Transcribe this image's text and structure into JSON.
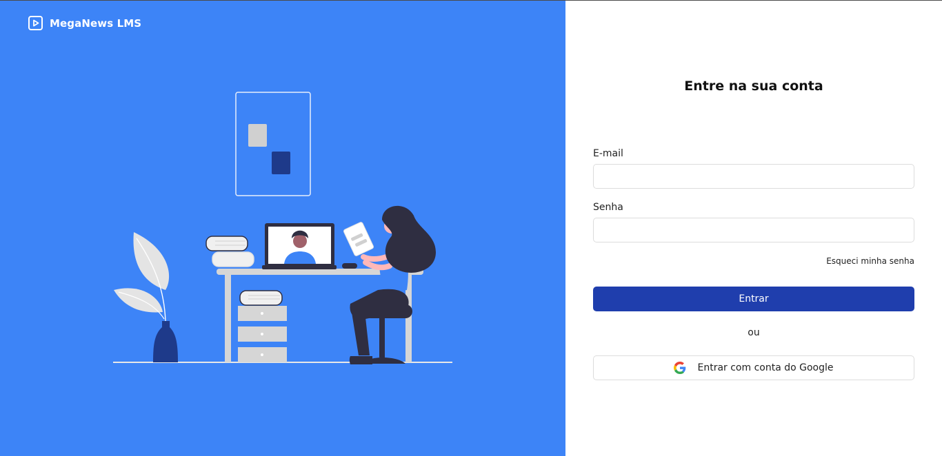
{
  "brand": {
    "name": "MegaNews LMS",
    "icon": "play-square-icon"
  },
  "login": {
    "title": "Entre na sua conta",
    "email_label": "E-mail",
    "email_value": "",
    "password_label": "Senha",
    "password_value": "",
    "forgot_link": "Esqueci minha senha",
    "submit_label": "Entrar",
    "divider_text": "ou",
    "google_label": "Entrar com conta do Google",
    "google_icon": "google-g-icon"
  },
  "colors": {
    "panel_blue": "#3d84f7",
    "primary_button": "#1f3ead",
    "dark_navy": "#1e3a8a"
  }
}
